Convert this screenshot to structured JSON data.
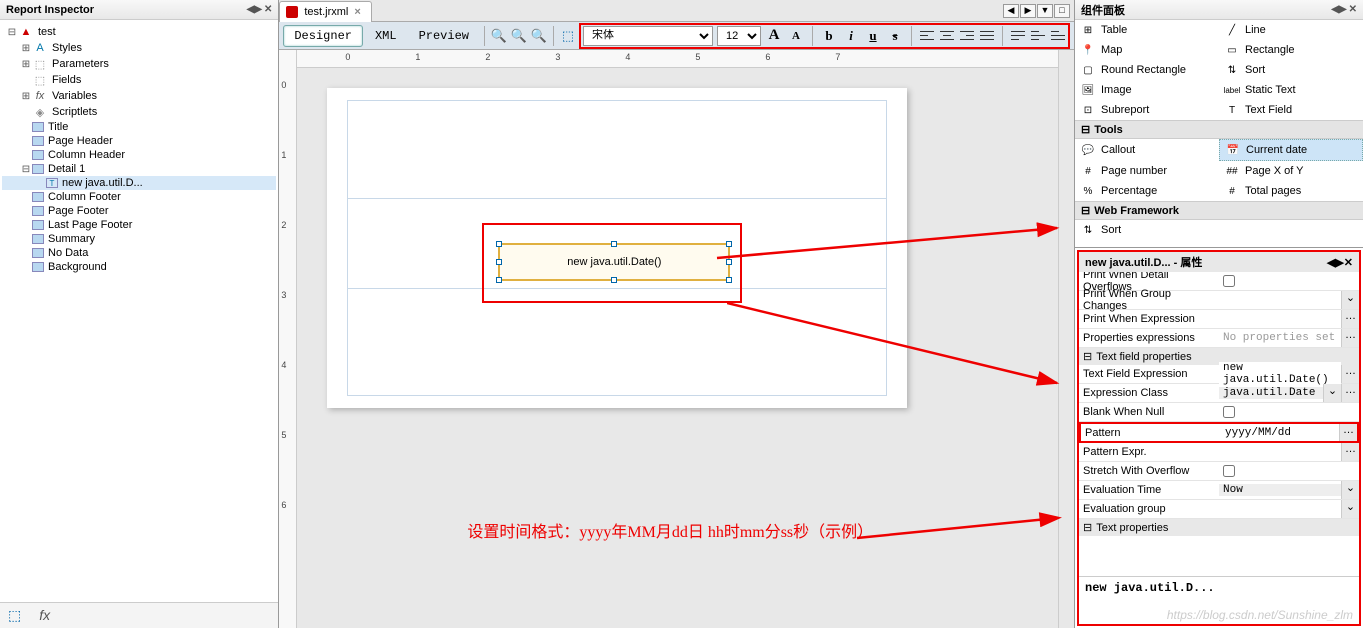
{
  "left_panel": {
    "title": "Report Inspector",
    "tree": {
      "root": "test",
      "styles": "Styles",
      "parameters": "Parameters",
      "fields": "Fields",
      "variables": "Variables",
      "scriptlets": "Scriptlets",
      "title_band": "Title",
      "page_header": "Page Header",
      "column_header": "Column Header",
      "detail1": "Detail 1",
      "detail_field": "new java.util.D...",
      "column_footer": "Column Footer",
      "page_footer": "Page Footer",
      "last_page_footer": "Last Page Footer",
      "summary": "Summary",
      "no_data": "No Data",
      "background": "Background"
    }
  },
  "tabs": {
    "file": "test.jrxml"
  },
  "toolbar": {
    "designer": "Designer",
    "xml": "XML",
    "preview": "Preview",
    "font": "宋体",
    "size": "12"
  },
  "canvas": {
    "field_text": "new java.util.Date()",
    "annotation": "设置时间格式：yyyy年MM月dd日 hh时mm分ss秒（示例）"
  },
  "hruler": {
    "t0": "0",
    "t1": "1",
    "t2": "2",
    "t3": "3",
    "t4": "4",
    "t5": "5",
    "t6": "6",
    "t7": "7"
  },
  "vruler": {
    "t0": "0",
    "t1": "1",
    "t2": "2",
    "t3": "3",
    "t4": "4",
    "t5": "5",
    "t6": "6"
  },
  "palette": {
    "title": "组件面板",
    "table": "Table",
    "line": "Line",
    "map": "Map",
    "rectangle": "Rectangle",
    "roundrect": "Round Rectangle",
    "sort": "Sort",
    "image": "Image",
    "statictext": "Static Text",
    "subreport": "Subreport",
    "textfield": "Text Field",
    "cat_tools": "Tools",
    "callout": "Callout",
    "currentdate": "Current date",
    "pagenum": "Page number",
    "pagexofy": "Page X of Y",
    "percentage": "Percentage",
    "totalpages": "Total pages",
    "cat_webfw": "Web Framework",
    "sort2": "Sort"
  },
  "props": {
    "title": "new java.util.D... - 属性",
    "print_when_overflow": "Print When Detail Overflows",
    "print_when_group": "Print When Group Changes",
    "print_when_expr": "Print When Expression",
    "props_expr": "Properties expressions",
    "props_expr_val": "No properties set",
    "cat_tfprops": "Text field properties",
    "tf_expr": "Text Field Expression",
    "tf_expr_val": "new java.util.Date()",
    "expr_class": "Expression Class",
    "expr_class_val": "java.util.Date",
    "blank_null": "Blank When Null",
    "pattern": "Pattern",
    "pattern_val": "yyyy/MM/dd",
    "pattern_expr": "Pattern Expr.",
    "stretch": "Stretch With Overflow",
    "eval_time": "Evaluation Time",
    "eval_time_val": "Now",
    "eval_group": "Evaluation group",
    "cat_textprops": "Text properties",
    "footer": "new java.util.D..."
  },
  "watermark": "https://blog.csdn.net/Sunshine_zlm"
}
